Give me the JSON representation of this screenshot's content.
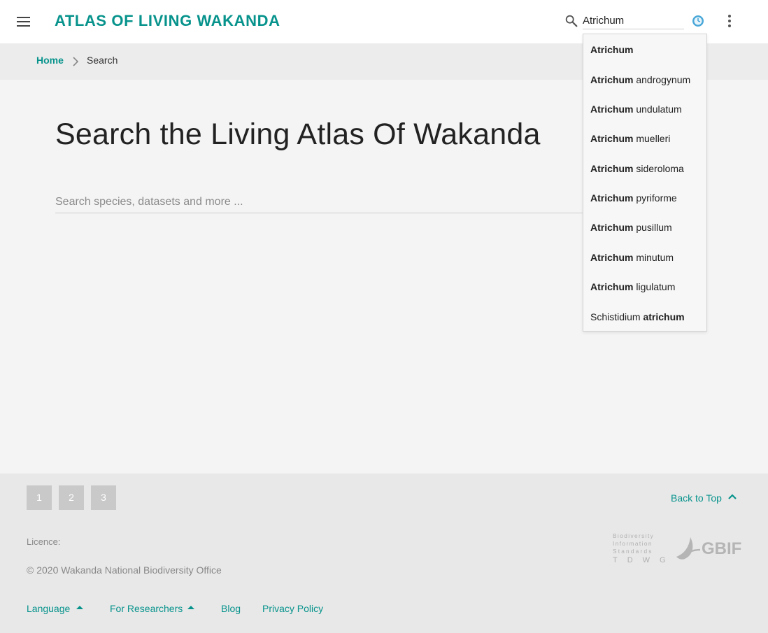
{
  "colors": {
    "accent": "#07938c",
    "background": "#f4f4f4",
    "header_bg": "#ffffff",
    "breadcrumb_bg": "#ececec",
    "footer_bg": "#e8e8e8"
  },
  "header": {
    "brand": "ATLAS OF LIVING WAKANDA",
    "menu_icon": "menu-icon",
    "search_icon": "search-icon",
    "search_value": "Atrichum",
    "history_icon": "clock-icon",
    "more_icon": "more-vert-icon"
  },
  "breadcrumb": {
    "home": "Home",
    "current": "Search"
  },
  "main": {
    "title": "Search the Living Atlas Of Wakanda",
    "search_placeholder": "Search species, datasets and more ..."
  },
  "autocomplete": [
    {
      "pre": "",
      "match": "Atrichum",
      "post": ""
    },
    {
      "pre": "",
      "match": "Atrichum",
      "post": " androgynum"
    },
    {
      "pre": "",
      "match": "Atrichum",
      "post": " undulatum"
    },
    {
      "pre": "",
      "match": "Atrichum",
      "post": " muelleri"
    },
    {
      "pre": "",
      "match": "Atrichum",
      "post": " sideroloma"
    },
    {
      "pre": "",
      "match": "Atrichum",
      "post": " pyriforme"
    },
    {
      "pre": "",
      "match": "Atrichum",
      "post": " pusillum"
    },
    {
      "pre": "",
      "match": "Atrichum",
      "post": " minutum"
    },
    {
      "pre": "",
      "match": "Atrichum",
      "post": " ligulatum"
    },
    {
      "pre": "Schistidium ",
      "match": "atrichum",
      "post": ""
    }
  ],
  "footer": {
    "pages": [
      "1",
      "2",
      "3"
    ],
    "back_to_top": "Back to Top",
    "licence": "Licence:",
    "copyright": "© 2020 Wakanda National Biodiversity Office",
    "logo_tdwg": "Biodiversity Information Standards TDWG",
    "logo_gbif": "GBIF",
    "links": {
      "language": "Language",
      "researchers": "For Researchers",
      "blog": "Blog",
      "privacy": "Privacy Policy"
    }
  }
}
